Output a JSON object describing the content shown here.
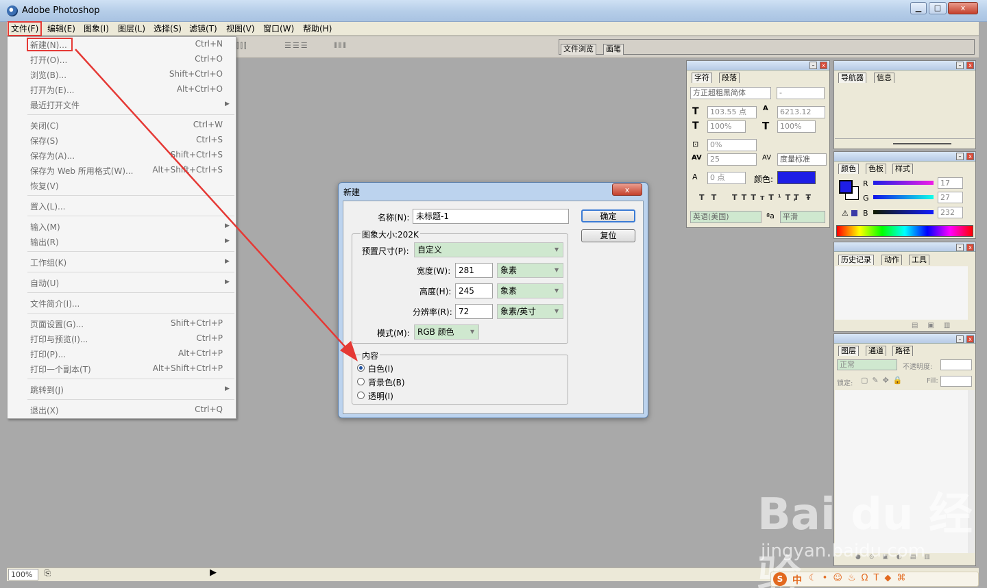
{
  "window": {
    "title": "Adobe Photoshop",
    "min": "0",
    "max": "□",
    "close": "x"
  },
  "menu": [
    "文件(F)",
    "编辑(E)",
    "图象(I)",
    "图层(L)",
    "选择(S)",
    "滤镜(T)",
    "视图(V)",
    "窗口(W)",
    "帮助(H)"
  ],
  "file_menu": [
    {
      "label": "新建(N)...",
      "shortcut": "Ctrl+N"
    },
    {
      "label": "打开(O)...",
      "shortcut": "Ctrl+O"
    },
    {
      "label": "浏览(B)...",
      "shortcut": "Shift+Ctrl+O"
    },
    {
      "label": "打开为(E)...",
      "shortcut": "Alt+Ctrl+O"
    },
    {
      "label": "最近打开文件",
      "shortcut": ""
    },
    {
      "label": "关闭(C)",
      "shortcut": "Ctrl+W"
    },
    {
      "label": "保存(S)",
      "shortcut": "Ctrl+S"
    },
    {
      "label": "保存为(A)...",
      "shortcut": "Shift+Ctrl+S"
    },
    {
      "label": "保存为 Web 所用格式(W)...",
      "shortcut": "Alt+Shift+Ctrl+S"
    },
    {
      "label": "恢复(V)",
      "shortcut": ""
    },
    {
      "label": "置入(L)...",
      "shortcut": ""
    },
    {
      "label": "输入(M)",
      "shortcut": ""
    },
    {
      "label": "输出(R)",
      "shortcut": ""
    },
    {
      "label": "工作组(K)",
      "shortcut": ""
    },
    {
      "label": "自动(U)",
      "shortcut": ""
    },
    {
      "label": "文件简介(I)...",
      "shortcut": ""
    },
    {
      "label": "页面设置(G)...",
      "shortcut": "Shift+Ctrl+P"
    },
    {
      "label": "打印与预览(I)...",
      "shortcut": "Ctrl+P"
    },
    {
      "label": "打印(P)...",
      "shortcut": "Alt+Ctrl+P"
    },
    {
      "label": "打印一个副本(T)",
      "shortcut": "Alt+Shift+Ctrl+P"
    },
    {
      "label": "跳转到(J)",
      "shortcut": ""
    },
    {
      "label": "退出(X)",
      "shortcut": "Ctrl+Q"
    }
  ],
  "options_bar": {
    "tab_browser": "文件浏览",
    "tab_brushes": "画笔"
  },
  "character_panel": {
    "tab_char": "字符",
    "tab_para": "段落",
    "font": "方正超粗黑简体",
    "style": "-",
    "size": "103.55 点",
    "leading": "6213.12",
    "vscale": "100%",
    "hscale": "100%",
    "tracking_pct": "0%",
    "kerning": "25",
    "kern_mode": "度量标准",
    "baseline": "0 点",
    "color_label": "颜色:",
    "color": "#1e1ee6",
    "styles": [
      "T",
      "T",
      "TT",
      "Tт",
      "T¹",
      "T,",
      "T",
      "Ŧ"
    ],
    "lang": "英语(美国)",
    "aa_label": "a a",
    "aa": "平滑"
  },
  "navigator_panel": {
    "tab_nav": "导航器",
    "tab_info": "信息"
  },
  "color_panel": {
    "tab_color": "颜色",
    "tab_swatches": "色板",
    "tab_styles": "样式",
    "r_label": "R",
    "g_label": "G",
    "b_label": "B",
    "r": "17",
    "g": "27",
    "b": "232"
  },
  "history_panel": {
    "tab_history": "历史记录",
    "tab_actions": "动作",
    "tab_tools": "工具"
  },
  "layers_panel": {
    "tab_layers": "图层",
    "tab_channels": "通道",
    "tab_paths": "路径",
    "blend": "正常",
    "opacity_label": "不透明度:",
    "lock_label": "锁定:",
    "fill_label": "Fill:"
  },
  "dialog": {
    "title": "新建",
    "name_label": "名称(N):",
    "name": "未标题-1",
    "ok": "确定",
    "reset": "复位",
    "image_size": "图象大小:202K",
    "preset_label": "预置尺寸(P):",
    "preset": "自定义",
    "width_label": "宽度(W):",
    "width": "281",
    "width_unit": "象素",
    "height_label": "高度(H):",
    "height": "245",
    "height_unit": "象素",
    "res_label": "分辨率(R):",
    "res": "72",
    "res_unit": "象素/英寸",
    "mode_label": "模式(M):",
    "mode": "RGB 颜色",
    "contents_label": "内容",
    "opt_white": "白色(I)",
    "opt_bg": "背景色(B)",
    "opt_transparent": "透明(I)"
  },
  "status": {
    "zoom": "100%"
  },
  "watermark": {
    "brand": "Bai du 经验",
    "url": "jingyan.baidu.com"
  },
  "tray_text": "中"
}
